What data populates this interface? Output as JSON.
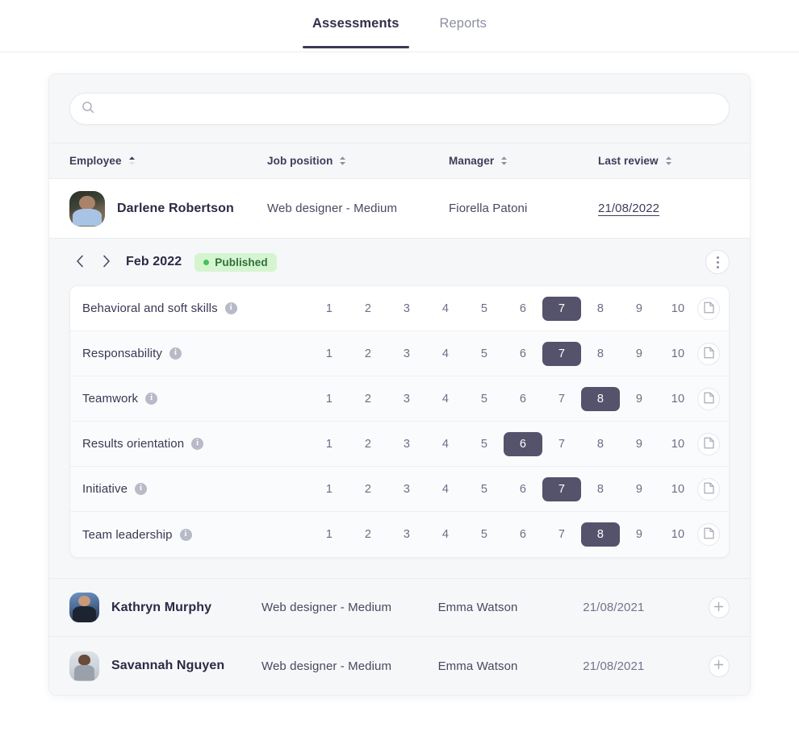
{
  "tabs": [
    {
      "label": "Assessments",
      "active": true
    },
    {
      "label": "Reports",
      "active": false
    }
  ],
  "search": {
    "value": "",
    "placeholder": "",
    "icon": "search-icon"
  },
  "table": {
    "columns": [
      {
        "label": "Employee",
        "sort": "asc",
        "key": "employee"
      },
      {
        "label": "Job position",
        "sort": "none",
        "key": "job"
      },
      {
        "label": "Manager",
        "sort": "none",
        "key": "manager"
      },
      {
        "label": "Last review",
        "sort": "none",
        "key": "review"
      }
    ],
    "rows": [
      {
        "name": "Darlene Robertson",
        "job": "Web designer - Medium",
        "manager": "Fiorella Patoni",
        "last_review": "21/08/2022",
        "expanded": true,
        "avatar": "avatar-darlene-robertson"
      },
      {
        "name": "Kathryn Murphy",
        "job": "Web designer - Medium",
        "manager": "Emma Watson",
        "last_review": "21/08/2021",
        "expanded": false,
        "action": "add-assessment-button",
        "avatar": "avatar-kathryn-murphy"
      },
      {
        "name": "Savannah Nguyen",
        "job": "Web designer - Medium",
        "manager": "Emma Watson",
        "last_review": "21/08/2021",
        "expanded": false,
        "action": "add-assessment-button",
        "avatar": "avatar-savannah-nguyen"
      }
    ]
  },
  "assessment": {
    "period": "Feb 2022",
    "status": "Published",
    "status_color": "#45c257",
    "status_bg": "#d5f5d0",
    "prev_label": "Previous period",
    "next_label": "Next period",
    "menu_label": "More options",
    "scale": [
      "1",
      "2",
      "3",
      "4",
      "5",
      "6",
      "7",
      "8",
      "9",
      "10"
    ],
    "selected_color": "#55526c",
    "skills": [
      {
        "name": "Behavioral and soft skills",
        "rating": 7,
        "info": "info-icon",
        "note": "note-icon"
      },
      {
        "name": "Responsability",
        "rating": 7,
        "info": "info-icon",
        "note": "note-icon"
      },
      {
        "name": "Teamwork",
        "rating": 8,
        "info": "info-icon",
        "note": "note-icon"
      },
      {
        "name": "Results orientation",
        "rating": 6,
        "info": "info-icon",
        "note": "note-icon"
      },
      {
        "name": "Initiative",
        "rating": 7,
        "info": "info-icon",
        "note": "note-icon"
      },
      {
        "name": "Team leadership",
        "rating": 8,
        "info": "info-icon",
        "note": "note-icon"
      }
    ]
  }
}
